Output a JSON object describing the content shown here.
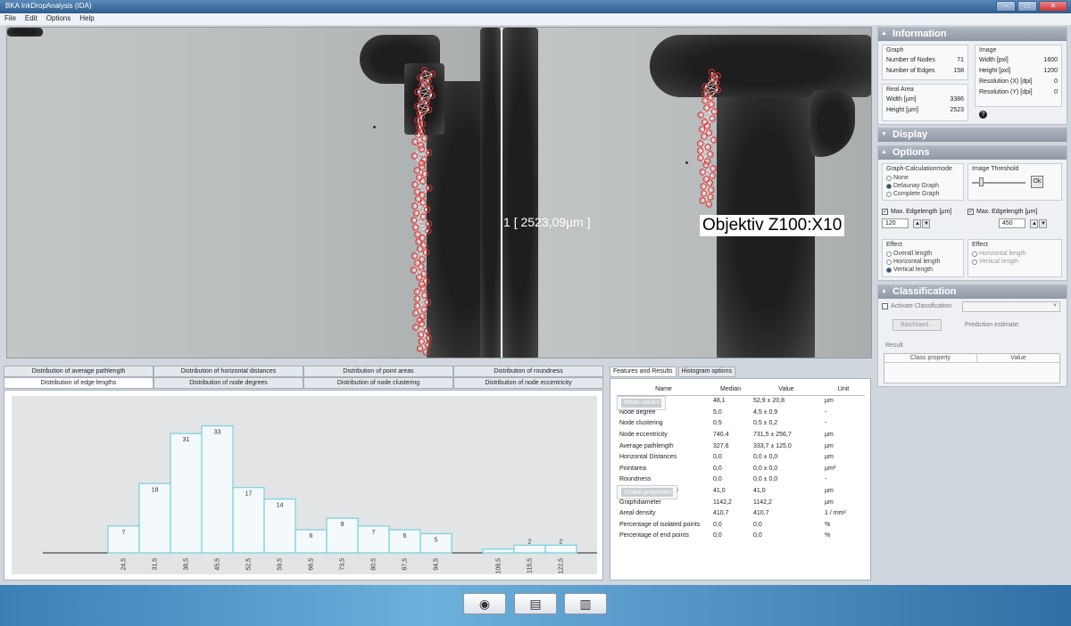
{
  "window": {
    "title": "BKA InkDropAnalysis (IDA)",
    "minimize": "–",
    "maximize": "□",
    "close": "✕"
  },
  "menu": [
    "File",
    "Edit",
    "Options",
    "Help"
  ],
  "viewer": {
    "measurement": "[ 2523,09µm ]",
    "measurement_marker": "1",
    "objective_label": "Objektiv Z100:X10"
  },
  "info": {
    "header": "Information",
    "graph": {
      "title": "Graph",
      "rows": [
        {
          "k": "Number of Nodes",
          "v": "71"
        },
        {
          "k": "Number of Edges",
          "v": "158"
        }
      ]
    },
    "real_area": {
      "title": "Real Area",
      "rows": [
        {
          "k": "Width [µm]",
          "v": "3386"
        },
        {
          "k": "Height [µm]",
          "v": "2523"
        }
      ]
    },
    "image": {
      "title": "Image",
      "rows": [
        {
          "k": "Width [pxl]",
          "v": "1600"
        },
        {
          "k": "Height [pxl]",
          "v": "1200"
        },
        {
          "k": "Resolution (X) [dpi]",
          "v": "0"
        },
        {
          "k": "Resolution (Y) [dpi]",
          "v": "0"
        }
      ]
    },
    "help_icon": "?"
  },
  "display": {
    "header": "Display"
  },
  "options": {
    "header": "Options",
    "calc_mode": {
      "title": "Graph-Calculationmode",
      "items": [
        "None",
        "Delaunay Graph",
        "Complete Graph"
      ],
      "selected": 1
    },
    "threshold": {
      "title": "Image Threshold",
      "ok": "Ok"
    },
    "edge1": {
      "label": "Max. Edgelength [µm]",
      "value": "120"
    },
    "edge2": {
      "label": "Max. Edgelength [µm]",
      "value": "450"
    },
    "effect1": {
      "title": "Effect",
      "items": [
        "Overall length",
        "Horizontal length",
        "Vertical length"
      ],
      "selected": 2
    },
    "effect2": {
      "title": "Effect",
      "items": [
        "Horizontal length",
        "Vertical length"
      ]
    }
  },
  "classification": {
    "header": "Classification",
    "activate": "Activate Classification",
    "batch": "Batchlaed...",
    "prediction": "Prediction estimate:",
    "result": "Result",
    "col_class": "Class property",
    "col_value": "Value"
  },
  "tabs_top": [
    "Distribution of average pathlength",
    "Distribution of horizontal distances",
    "Distribution of point areas",
    "Distribution of roundness"
  ],
  "tabs_bottom": [
    "Distribution of edge lengths",
    "Distribution of node degrees",
    "Distribution of node clustering",
    "Distribution of node eccentricity"
  ],
  "chart_data": {
    "type": "bar",
    "title": "Distribution of edge lengths",
    "categories": [
      "24,5",
      "31,5",
      "38,5",
      "45,5",
      "52,5",
      "59,5",
      "66,5",
      "73,5",
      "80,5",
      "87,5",
      "94,5",
      "101,5",
      "108,5",
      "115,5",
      "122,5"
    ],
    "tick_labels": [
      "24,5",
      "31,5",
      "38,5",
      "45,5",
      "52,5",
      "59,5",
      "66,5",
      "73,5",
      "80,5",
      "87,5",
      "94,5",
      "",
      "108,5",
      "115,5",
      "122,5"
    ],
    "values": [
      7,
      18,
      31,
      33,
      17,
      14,
      6,
      9,
      7,
      6,
      5,
      0,
      1,
      2,
      2
    ],
    "value_labels": [
      "7",
      "18",
      "31",
      "33",
      "17",
      "14",
      "6",
      "9",
      "7",
      "6",
      "5",
      "",
      "",
      "2",
      "2"
    ],
    "ylim": [
      0,
      38
    ],
    "grid": false,
    "xlabel": "",
    "ylabel": ""
  },
  "results": {
    "tabs": [
      "Features and Results",
      "Histogram options"
    ],
    "columns": [
      "Name",
      "Median",
      "Value",
      "Unit"
    ],
    "groups": [
      {
        "title": "Mean values:",
        "rows": [
          [
            "Edge length",
            "48,1",
            "52,9 ± 20,8",
            "µm"
          ],
          [
            "Node degree",
            "5,0",
            "4,5 ± 0,9",
            "-"
          ],
          [
            "Node clustering",
            "0,5",
            "0,5 ± 0,2",
            "-"
          ],
          [
            "Node eccentricity",
            "740,4",
            "731,5 ± 256,7",
            "µm"
          ],
          [
            "Average pathlength",
            "327,6",
            "333,7 ± 125,0",
            "µm"
          ],
          [
            "Horizontal Distances",
            "0,0",
            "0,0 ± 0,0",
            "µm"
          ],
          [
            "Pointarea",
            "0,0",
            "0,0 ± 0,0",
            "µm²"
          ],
          [
            "Roundness",
            "0,0",
            "0,0 ± 0,0",
            "-"
          ]
        ]
      },
      {
        "title": "Global properties:",
        "rows": [
          [
            "Vertical Maindistance",
            "41,0",
            "41,0",
            "µm"
          ],
          [
            "Graphdiameter",
            "1142,2",
            "1142,2",
            "µm"
          ],
          [
            "Areal density",
            "410,7",
            "410,7",
            "1 / mm²"
          ],
          [
            "Percentage of isolated points",
            "0,0",
            "0,0",
            "%"
          ],
          [
            "Percentage of end points",
            "0,0",
            "0,0",
            "%"
          ]
        ]
      }
    ]
  },
  "taskbar": {
    "icons": [
      "disc-icon",
      "printer-icon",
      "report-icon"
    ],
    "glyphs": [
      "◉",
      "▤",
      "▥"
    ]
  }
}
